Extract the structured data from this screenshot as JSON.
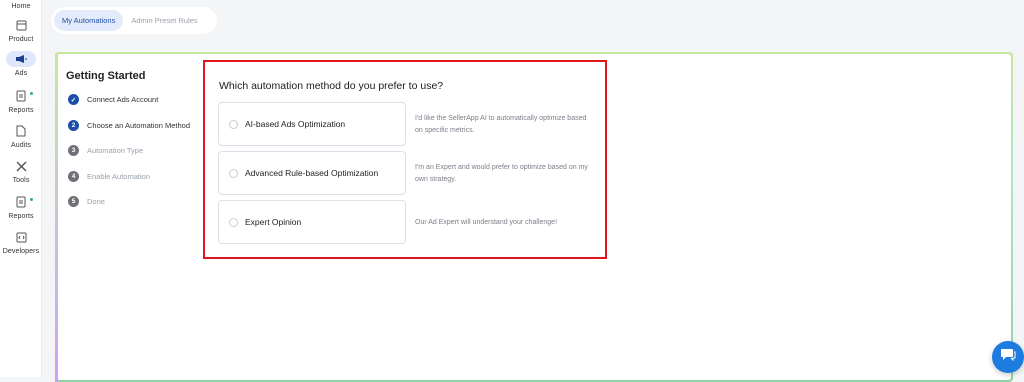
{
  "sidebar": {
    "items": [
      {
        "label": "Home",
        "icon": "home-icon"
      },
      {
        "label": "Product",
        "icon": "product-icon"
      },
      {
        "label": "Ads",
        "icon": "megaphone-icon"
      },
      {
        "label": "Reports",
        "icon": "report-icon"
      },
      {
        "label": "Audits",
        "icon": "audit-icon"
      },
      {
        "label": "Tools",
        "icon": "tools-icon"
      },
      {
        "label": "Reports",
        "icon": "report-icon"
      },
      {
        "label": "Developers",
        "icon": "code-icon"
      }
    ]
  },
  "tabs": [
    {
      "label": "My Automations",
      "active": true
    },
    {
      "label": "Admin Preset Rules",
      "active": false
    }
  ],
  "steps": {
    "title": "Getting Started",
    "items": [
      {
        "num": "✓",
        "label": "Connect Ads Account",
        "state": "done"
      },
      {
        "num": "2",
        "label": "Choose an Automation Method",
        "state": "current"
      },
      {
        "num": "3",
        "label": "Automation Type",
        "state": "pending"
      },
      {
        "num": "4",
        "label": "Enable Automation",
        "state": "pending"
      },
      {
        "num": "5",
        "label": "Done",
        "state": "pending"
      }
    ]
  },
  "panel": {
    "question": "Which automation method do you prefer to use?",
    "options": [
      {
        "label": "AI-based Ads Optimization",
        "desc": "I'd like the SellerApp AI to automatically optimize based on specific metrics."
      },
      {
        "label": "Advanced Rule-based Optimization",
        "desc": "I'm an Expert and would prefer to optimize based on my own strategy."
      },
      {
        "label": "Expert Opinion",
        "desc": "Our Ad Expert will understand your challenge!"
      }
    ]
  },
  "colors": {
    "accent": "#1d4fa8",
    "highlight_border": "#e2141c",
    "chat": "#1e7be0"
  }
}
